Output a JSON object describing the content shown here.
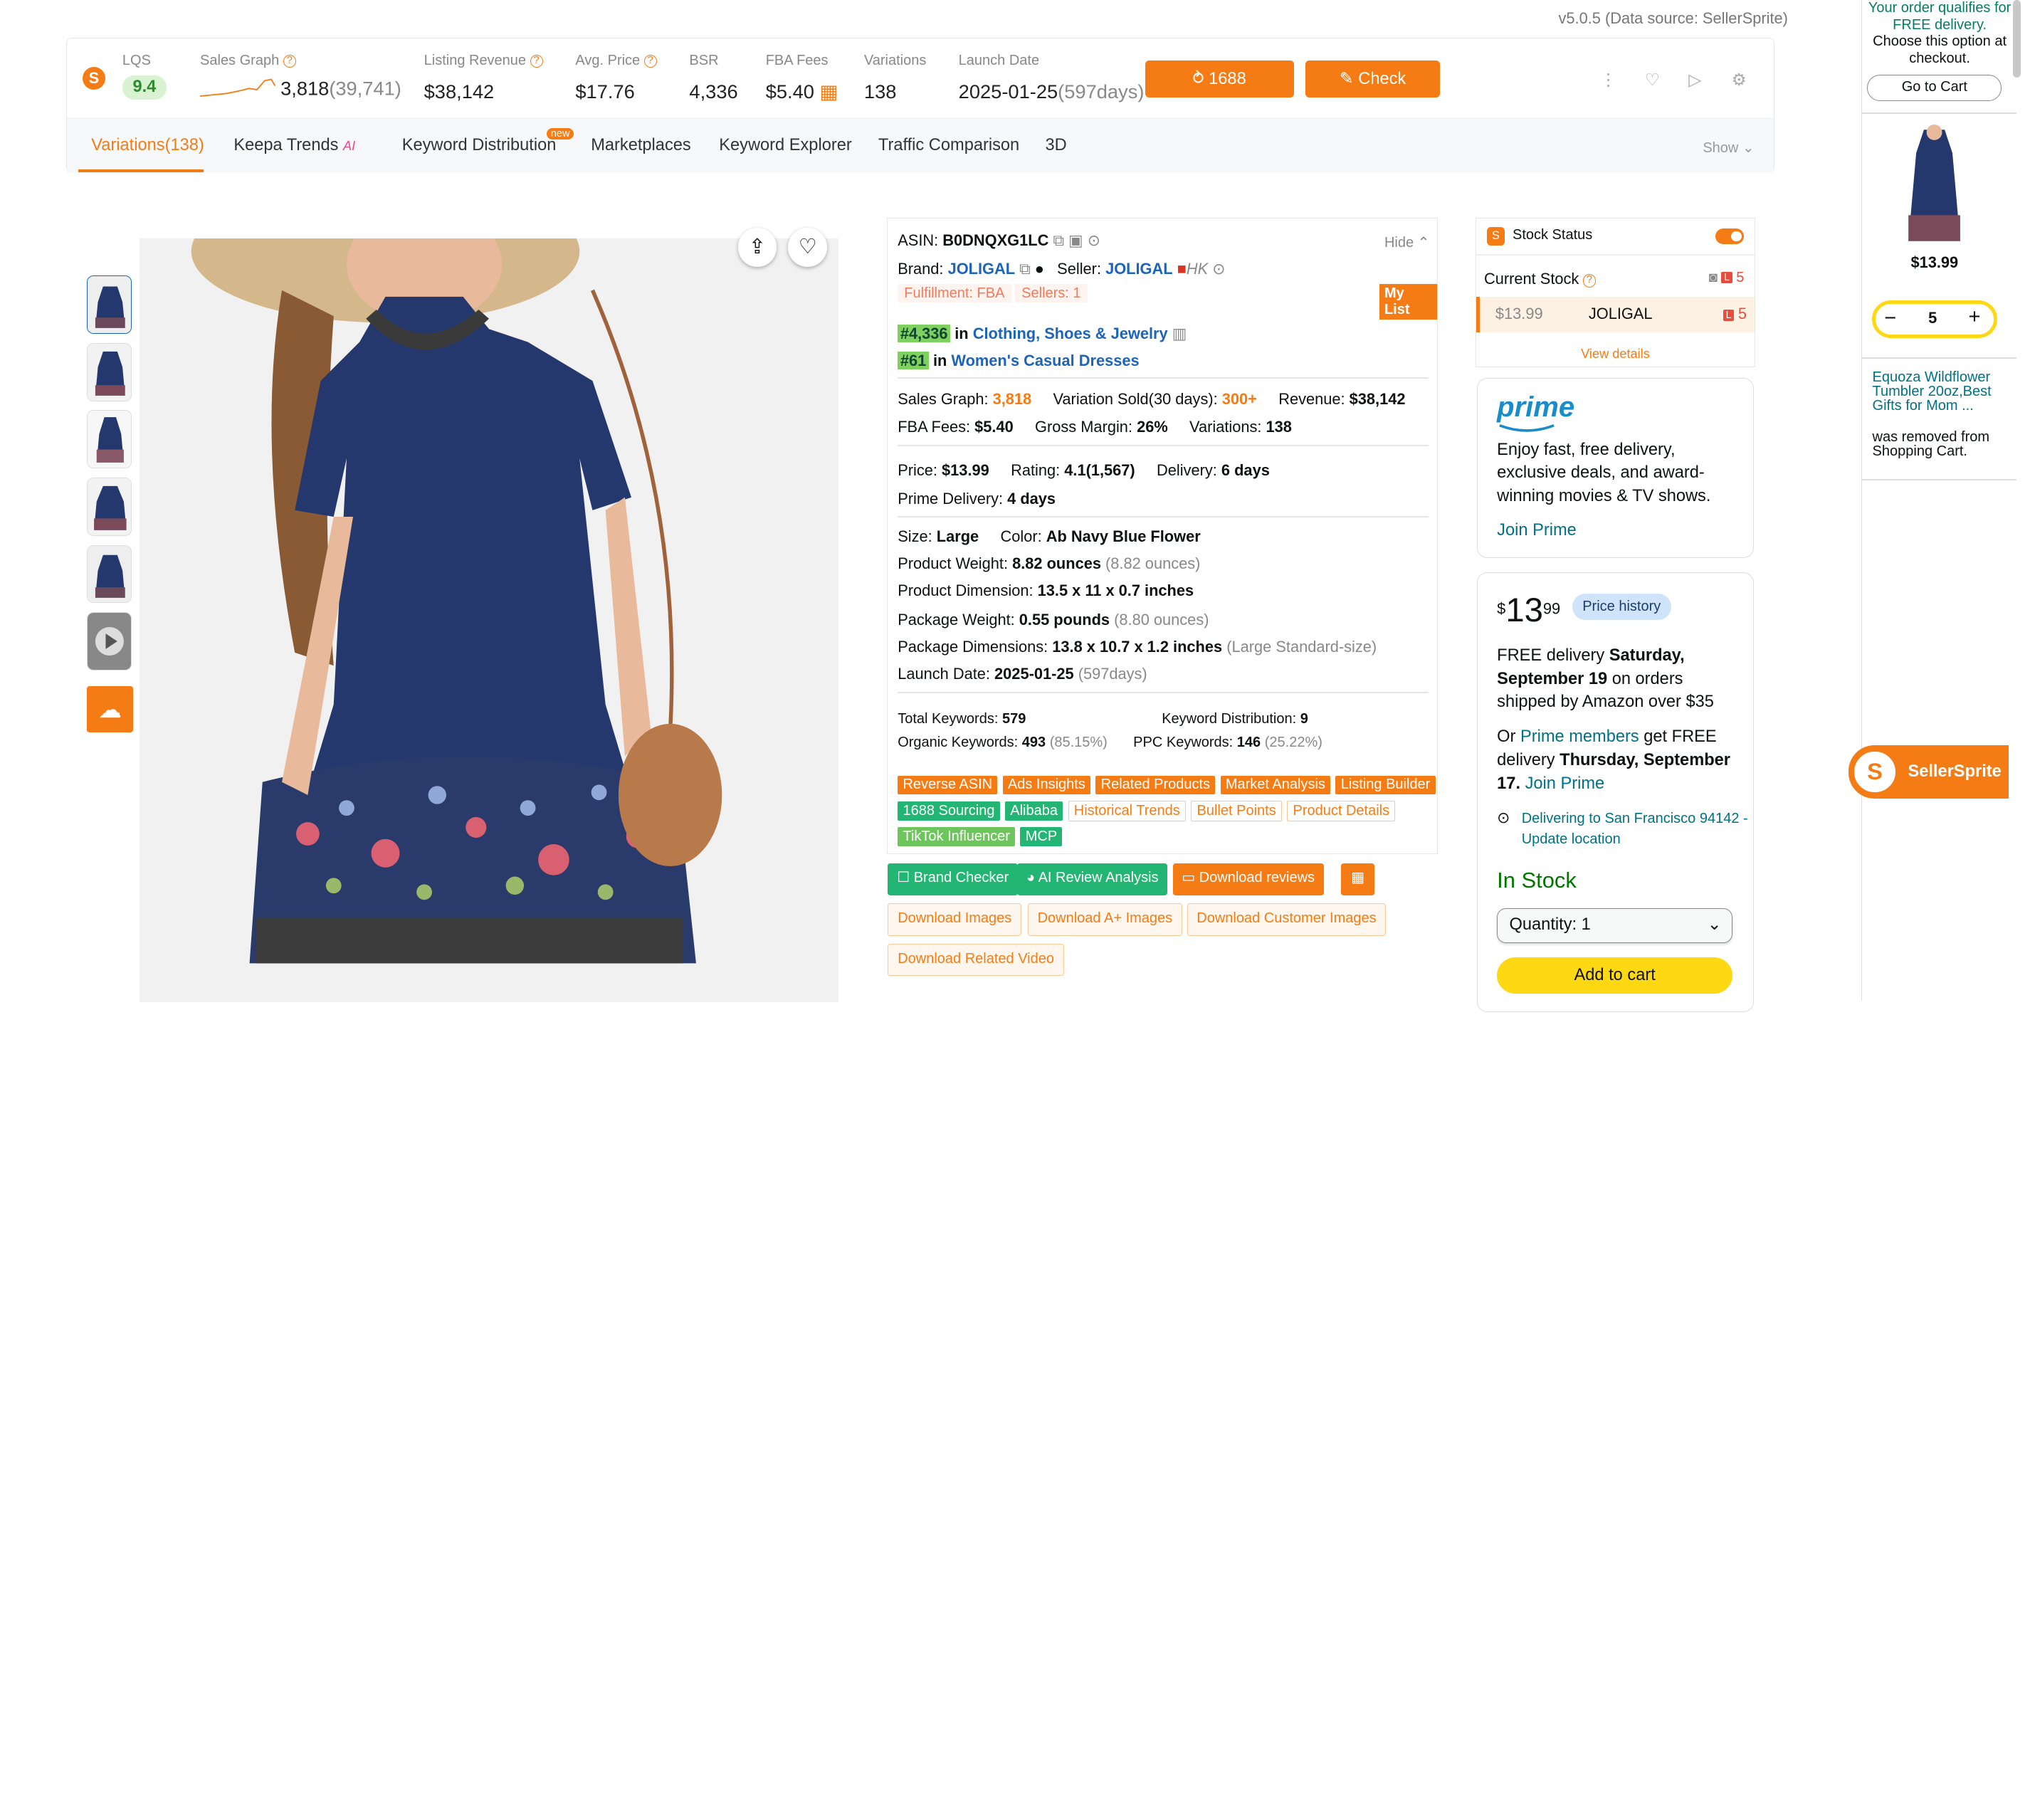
{
  "version": "v5.0.5 (Data source: SellerSprite)",
  "metrics": {
    "lqs_label": "LQS",
    "lqs_value": "9.4",
    "sales_graph_label": "Sales Graph",
    "sales_graph_value": "3,818",
    "sales_graph_sub": "(39,741)",
    "listing_revenue_label": "Listing Revenue",
    "listing_revenue_value": "$38,142",
    "avg_price_label": "Avg. Price",
    "avg_price_value": "$17.76",
    "bsr_label": "BSR",
    "bsr_value": "4,336",
    "fba_fees_label": "FBA Fees",
    "fba_fees_value": "$5.40",
    "variations_label": "Variations",
    "variations_value": "138",
    "launch_label": "Launch Date",
    "launch_value": "2025-01-25",
    "launch_days": "(597days)",
    "sourcing_btn": "1688 Sourcing",
    "patent_btn": "Check Patent"
  },
  "tabs": {
    "variations": "Variations(138)",
    "keepa": "Keepa Trends",
    "keepa_ai": "AI",
    "keyword_distribution": "Keyword Distribution",
    "new_badge": "new",
    "marketplaces": "Marketplaces",
    "keyword_explorer": "Keyword Explorer",
    "traffic": "Traffic Comparison",
    "three_d": "3D",
    "show": "Show"
  },
  "product": {
    "asin_label": "ASIN:",
    "asin": "B0DNQXG1LC",
    "hide": "Hide",
    "brand_label": "Brand:",
    "brand": "JOLIGAL",
    "seller_label": "Seller:",
    "seller": "JOLIGAL",
    "seller_region": "HK",
    "fulfillment": "Fulfillment: FBA",
    "sellers": "Sellers: 1",
    "mylist": "My List",
    "rank1": "#4,336",
    "rank1_in": "in",
    "rank1_cat": "Clothing, Shoes & Jewelry",
    "rank2": "#61",
    "rank2_in": "in",
    "rank2_cat": "Women's Casual Dresses",
    "sales_graph_label": "Sales Graph:",
    "sales_graph": "3,818",
    "variation_sold_label": "Variation Sold(30 days):",
    "variation_sold": "300+",
    "revenue_label": "Revenue:",
    "revenue": "$38,142",
    "fba_label": "FBA Fees:",
    "fba": "$5.40",
    "margin_label": "Gross Margin:",
    "margin": "26%",
    "variations_label": "Variations:",
    "variations": "138",
    "price_label": "Price:",
    "price": "$13.99",
    "rating_label": "Rating:",
    "rating": "4.1(1,567)",
    "delivery_label": "Delivery:",
    "delivery": "6 days",
    "prime_delivery_label": "Prime Delivery:",
    "prime_delivery": "4 days",
    "size_label": "Size:",
    "size": "Large",
    "color_label": "Color:",
    "color": "Ab Navy Blue Flower",
    "weight_label": "Product Weight:",
    "weight": "8.82 ounces",
    "weight_sub": "(8.82 ounces)",
    "dimension_label": "Product Dimension:",
    "dimension": "13.5 x 11 x 0.7 inches",
    "pkg_weight_label": "Package Weight:",
    "pkg_weight": "0.55 pounds",
    "pkg_weight_sub": "(8.80 ounces)",
    "pkg_dim_label": "Package Dimensions:",
    "pkg_dim": "13.8 x 10.7 x 1.2 inches",
    "pkg_dim_sub": "(Large Standard-size)",
    "launch_label": "Launch Date:",
    "launch": "2025-01-25",
    "launch_sub": "(597days)",
    "total_kw_label": "Total Keywords:",
    "total_kw": "579",
    "kw_dist_label": "Keyword Distribution:",
    "kw_dist": "9",
    "organic_label": "Organic Keywords:",
    "organic": "493",
    "organic_pct": "(85.15%)",
    "ppc_label": "PPC Keywords:",
    "ppc": "146",
    "ppc_pct": "(25.22%)"
  },
  "tags": {
    "reverse_asin": "Reverse ASIN",
    "ads_insights": "Ads Insights",
    "related": "Related Products",
    "market": "Market Analysis",
    "listing_builder": "Listing Builder",
    "sourcing": "1688 Sourcing",
    "alibaba": "Alibaba",
    "historical": "Historical Trends",
    "bullet": "Bullet Points",
    "details": "Product Details",
    "tiktok": "TikTok Influencer",
    "mcp": "MCP"
  },
  "actions": {
    "brand_checker": "Brand Checker",
    "ai_review": "AI Review Analysis",
    "download_reviews": "Download reviews",
    "download_images": "Download Images",
    "download_aplus": "Download A+ Images",
    "download_customer": "Download Customer Images",
    "download_video": "Download Related Video"
  },
  "stock": {
    "title": "Stock Status",
    "current_label": "Current Stock",
    "current_value": "5",
    "row_price": "$13.99",
    "row_seller": "JOLIGAL",
    "row_value": "5",
    "view_details": "View details"
  },
  "prime": {
    "logo": "prime",
    "text": "Enjoy fast, free delivery, exclusive deals, and award-winning movies & TV shows.",
    "join": "Join Prime"
  },
  "buybox": {
    "dollar": "$",
    "price_whole": "13",
    "price_cents": "99",
    "price_history": "Price history",
    "free_delivery_1": "FREE delivery ",
    "free_delivery_date": "Saturday, September 19",
    "free_delivery_2": " on orders shipped by Amazon over $35",
    "or": "Or ",
    "prime_members": "Prime members",
    "get_free": " get FREE delivery ",
    "prime_date": "Thursday, September 17.",
    "join_prime": "Join Prime",
    "location": "Delivering to San Francisco 94142 - Update location",
    "in_stock": "In Stock",
    "quantity_label": "Quantity:",
    "quantity": "1",
    "add_to_cart": "Add to cart"
  },
  "cart_sidebar": {
    "qualifies": "Your order qualifies for FREE delivery.",
    "choose": "Choose this option at checkout.",
    "go_to_cart": "Go to Cart",
    "item_price": "$13.99",
    "qty": "5",
    "removed_item": "Equoza Wildflower Tumbler 20oz,Best Gifts for Mom ...",
    "removed_text": "was removed from Shopping Cart."
  },
  "sellersprite_badge": "SellerSprite",
  "colors": {
    "accent": "#f57c14",
    "green": "#22b573",
    "link": "#1d64b8",
    "amazon_yellow": "#ffd814",
    "navy_dress": "#24386e"
  }
}
